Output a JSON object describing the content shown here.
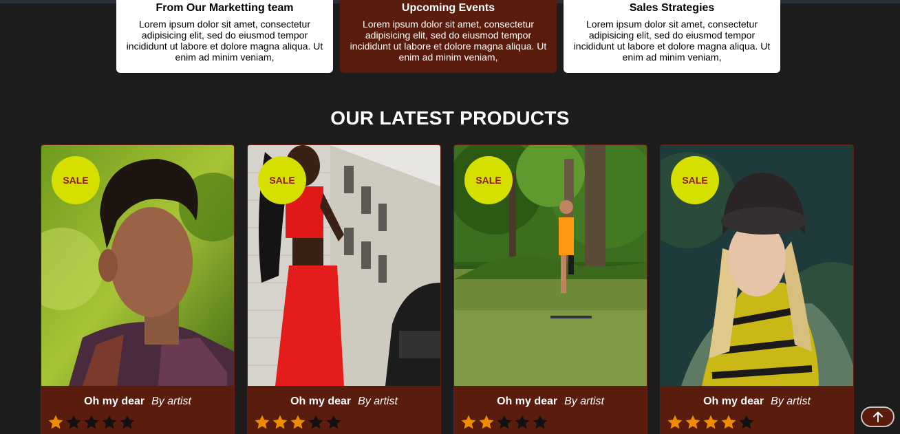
{
  "info_cards": [
    {
      "title": "From Our Marketting team",
      "text": "Lorem ipsum dolor sit amet, consectetur adipisicing elit, sed do eiusmod tempor incididunt ut labore et dolore magna aliqua. Ut enim ad minim veniam,"
    },
    {
      "title": "Upcoming Events",
      "text": "Lorem ipsum dolor sit amet, consectetur adipisicing elit, sed do eiusmod tempor incididunt ut labore et dolore magna aliqua. Ut enim ad minim veniam,"
    },
    {
      "title": "Sales Strategies",
      "text": "Lorem ipsum dolor sit amet, consectetur adipisicing elit, sed do eiusmod tempor incididunt ut labore et dolore magna aliqua. Ut enim ad minim veniam,"
    }
  ],
  "products_section": {
    "title": "OUR LATEST PRODUCTS"
  },
  "products": [
    {
      "badge": "SALE",
      "name": "Oh my dear",
      "artist": "By artist",
      "rating": 1
    },
    {
      "badge": "SALE",
      "name": "Oh my dear",
      "artist": "By artist",
      "rating": 3
    },
    {
      "badge": "SALE",
      "name": "Oh my dear",
      "artist": "By artist",
      "rating": 2
    },
    {
      "badge": "SALE",
      "name": "Oh my dear",
      "artist": "By artist",
      "rating": 4
    }
  ],
  "colors": {
    "accent": "#5a1d0d",
    "sale_badge": "#d5e000",
    "star_filled": "#f08c00",
    "star_empty": "#111111"
  },
  "icons": {
    "scroll_top": "arrow-up-icon",
    "star": "star-icon"
  }
}
